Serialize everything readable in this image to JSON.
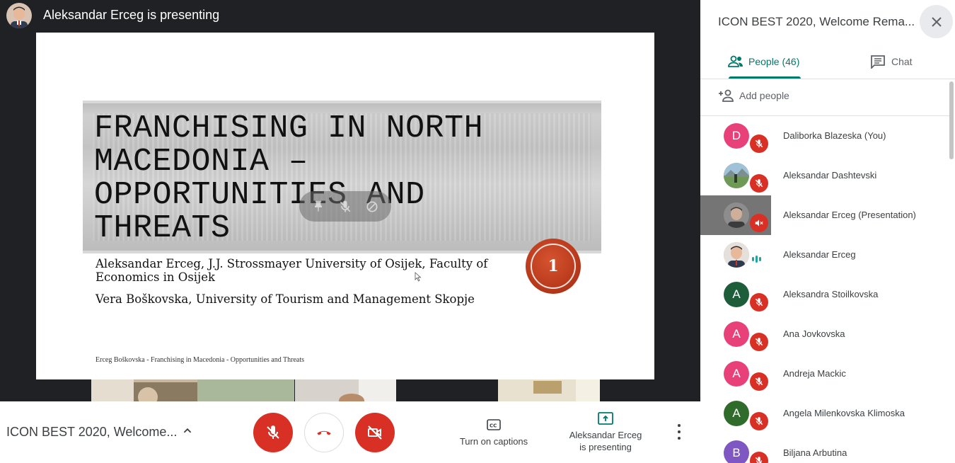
{
  "presenter": {
    "banner": "Aleksandar Erceg is presenting"
  },
  "slide": {
    "title_lines": [
      "FRANCHISING IN NORTH",
      "MACEDONIA –",
      "OPPORTUNITIES AND",
      "THREATS"
    ],
    "authors_line1": "Aleksandar Erceg, J.J. Strossmayer University of Osijek, Faculty of",
    "authors_line2": "Economics in Osijek",
    "authors_line3": "Vera Boškovska, University of Tourism and Management Skopje",
    "footer": "Erceg Boškovska - Franchising in Macedonia - Opportunities and Threats",
    "page_number": "1"
  },
  "bottom_bar": {
    "meeting_title": "ICON BEST 2020, Welcome...",
    "captions_label": "Turn on captions",
    "presenting_line1": "Aleksandar Erceg",
    "presenting_line2": "is presenting"
  },
  "panel": {
    "title": "ICON BEST 2020, Welcome Rema...",
    "tabs": [
      {
        "label": "People (46)",
        "icon": "people-icon",
        "active": true
      },
      {
        "label": "Chat",
        "icon": "chat-icon",
        "active": false
      }
    ],
    "add_people": "Add people",
    "people": [
      {
        "name": "Daliborka Blazeska (You)",
        "initial": "D",
        "color": "#e8417a",
        "status": "muted"
      },
      {
        "name": "Aleksandar Dashtevski",
        "initial": "",
        "color": "#7aa36b",
        "status": "muted",
        "photo": true
      },
      {
        "name": "Aleksandar Erceg (Presentation)",
        "initial": "",
        "color": "#8d8d8d",
        "status": "muted-presentation",
        "photo": true
      },
      {
        "name": "Aleksandar Erceg",
        "initial": "",
        "color": "#c9a88a",
        "status": "speaking",
        "photo": true
      },
      {
        "name": "Aleksandra Stoilkovska",
        "initial": "A",
        "color": "#1e5d3a",
        "status": "muted"
      },
      {
        "name": "Ana Jovkovska",
        "initial": "A",
        "color": "#e8417a",
        "status": "muted"
      },
      {
        "name": "Andreja Mackic",
        "initial": "A",
        "color": "#e8417a",
        "status": "muted"
      },
      {
        "name": "Angela Milenkovska Klimoska",
        "initial": "A",
        "color": "#2f6b2a",
        "status": "muted"
      },
      {
        "name": "Biljana Arbutina",
        "initial": "B",
        "color": "#7e57c2",
        "status": "muted"
      }
    ]
  },
  "colors": {
    "accent": "#00796b",
    "danger": "#d93025",
    "stage_bg": "#202124"
  }
}
